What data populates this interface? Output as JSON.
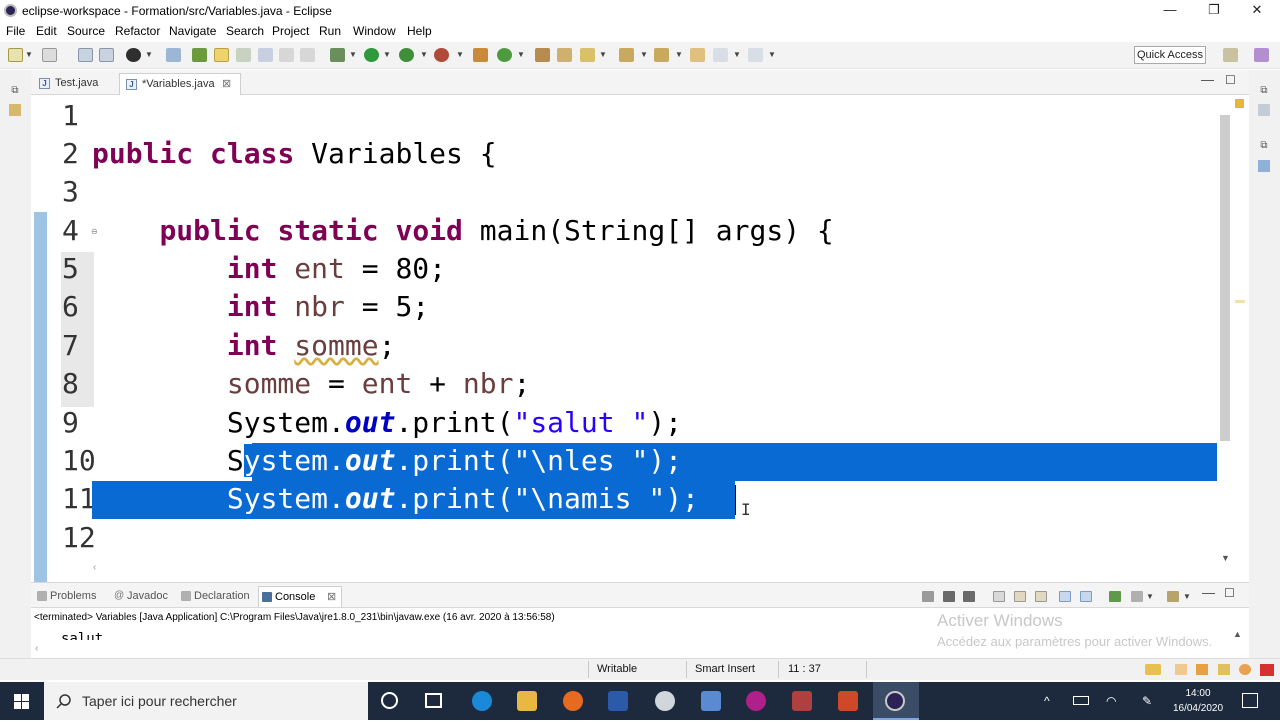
{
  "window": {
    "title": "eclipse-workspace - Formation/src/Variables.java - Eclipse",
    "minimize": "—",
    "restore": "❐",
    "close": "✕"
  },
  "menu": [
    "File",
    "Edit",
    "Source",
    "Refactor",
    "Navigate",
    "Search",
    "Project",
    "Run",
    "Window",
    "Help"
  ],
  "toolbar": {
    "quick_access": "Quick Access"
  },
  "editor_tabs": [
    {
      "label": "Test.java",
      "active": false
    },
    {
      "label": "*Variables.java",
      "active": true,
      "close": "⊠"
    }
  ],
  "code": {
    "line_numbers": [
      "1",
      "2",
      "3",
      "4",
      "5",
      "6",
      "7",
      "8",
      "9",
      "10",
      "11",
      "12"
    ],
    "lines": {
      "l2": [
        "public",
        " ",
        "class",
        " Variables {"
      ],
      "l4": [
        "public",
        " ",
        "static",
        " ",
        "void",
        " main(String[] args) {"
      ],
      "l5": [
        "int",
        " ",
        "ent",
        " = 80;"
      ],
      "l6": [
        "int",
        " ",
        "nbr",
        " = 5;"
      ],
      "l7": [
        "int",
        " ",
        "somme",
        ";"
      ],
      "l8": [
        "somme",
        " = ",
        "ent",
        " + ",
        "nbr",
        ";"
      ],
      "l9": [
        "System.",
        "out",
        ".print(",
        "\"salut \"",
        ");"
      ],
      "l10": [
        "S",
        "ystem.",
        "out",
        ".print(",
        "\"\\nles \"",
        ");"
      ],
      "l11": [
        "System.",
        "out",
        ".print(",
        "\"\\namis \"",
        ");"
      ]
    },
    "selection_color": "#0a6ad4"
  },
  "console": {
    "tabs": [
      "Problems",
      "Javadoc",
      "Declaration",
      "Console"
    ],
    "active_tab": "Console",
    "terminated": "<terminated> Variables [Java Application] C:\\Program Files\\Java\\jre1.8.0_231\\bin\\javaw.exe (16 avr. 2020 à 13:56:58)",
    "output": "salut"
  },
  "status": {
    "writable": "Writable",
    "insert_mode": "Smart Insert",
    "position": "11 : 37"
  },
  "watermark": {
    "title": "Activer Windows",
    "subtitle": "Accédez aux paramètres pour activer Windows."
  },
  "taskbar": {
    "search_placeholder": "Taper ici pour rechercher",
    "time": "14:00",
    "date": "16/04/2020"
  }
}
